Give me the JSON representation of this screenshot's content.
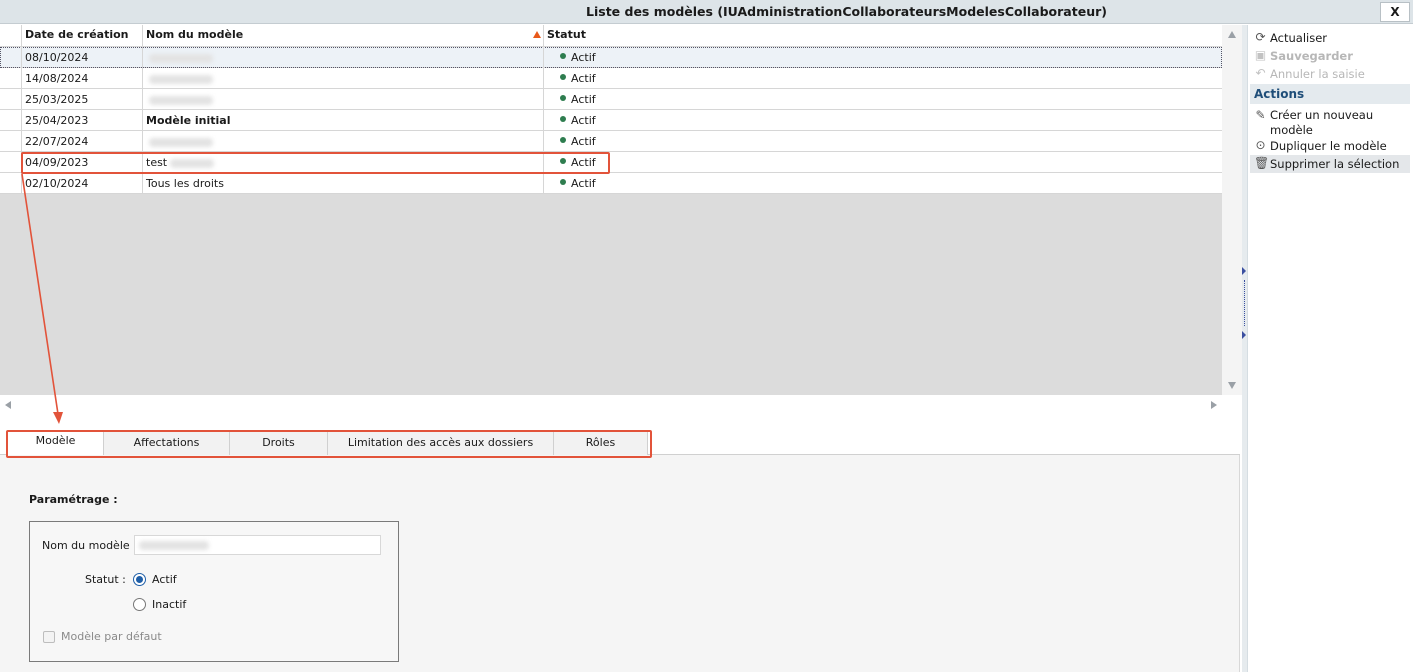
{
  "window": {
    "title": "Liste des modèles (IUAdministrationCollaborateursModelesCollaborateur)",
    "close_label": "X"
  },
  "grid": {
    "columns": [
      "Date de création",
      "Nom du modèle",
      "Statut"
    ],
    "sorted_column": "Nom du modèle",
    "sort_direction": "ascending",
    "rows": [
      {
        "date": "08/10/2024",
        "name": "",
        "name_redacted": true,
        "status": "Actif",
        "selected": true
      },
      {
        "date": "14/08/2024",
        "name": "",
        "name_redacted": true,
        "status": "Actif"
      },
      {
        "date": "25/03/2025",
        "name": "",
        "name_redacted": true,
        "status": "Actif"
      },
      {
        "date": "25/04/2023",
        "name": "Modèle initial",
        "status": "Actif",
        "bold": true
      },
      {
        "date": "22/07/2024",
        "name": "",
        "name_redacted": true,
        "status": "Actif"
      },
      {
        "date": "04/09/2023",
        "name": "test",
        "name_redacted_suffix": true,
        "status": "Actif"
      },
      {
        "date": "02/10/2024",
        "name": "Tous les droits",
        "status": "Actif"
      }
    ],
    "status_color": "#2e7d4f"
  },
  "actions_panel": {
    "items": [
      {
        "label": "Actualiser",
        "icon": "refresh-icon",
        "enabled": true
      },
      {
        "label": "Sauvegarder",
        "icon": "save-icon",
        "enabled": false
      },
      {
        "label": "Annuler la saisie",
        "icon": "undo-icon",
        "enabled": false
      }
    ],
    "section_title": "Actions",
    "actions": [
      {
        "label": "Créer un nouveau modèle",
        "icon": "pencil-icon"
      },
      {
        "label": "Dupliquer le modèle",
        "icon": "play-circle-icon"
      },
      {
        "label": "Supprimer la sélection",
        "icon": "trash-icon"
      }
    ]
  },
  "tabs": [
    {
      "label": "Modèle",
      "active": true
    },
    {
      "label": "Affectations"
    },
    {
      "label": "Droits"
    },
    {
      "label": "Limitation des accès aux dossiers"
    },
    {
      "label": "Rôles"
    }
  ],
  "form": {
    "section_title": "Paramétrage :",
    "name_label": "Nom du modèle :",
    "name_value": "",
    "status_label": "Statut :",
    "status_options": [
      "Actif",
      "Inactif"
    ],
    "status_selected": "Actif",
    "default_label": "Modèle par défaut",
    "default_checked": false
  },
  "annotation_color": "#e2533a"
}
